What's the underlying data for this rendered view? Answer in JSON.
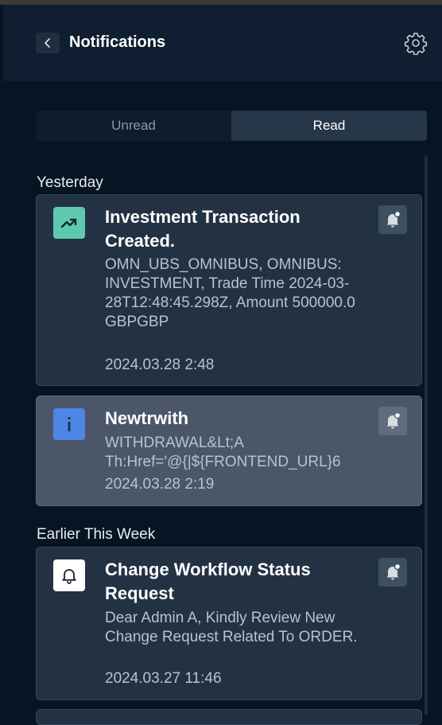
{
  "header": {
    "title": "Notifications",
    "back_icon": "chevron-left-icon",
    "settings_icon": "gear-icon"
  },
  "tabs": [
    {
      "label": "Unread",
      "active": false
    },
    {
      "label": "Read",
      "active": true
    }
  ],
  "sections": [
    {
      "label": "Yesterday",
      "items": [
        {
          "icon": "trending-up-icon",
          "icon_color": "#5ec9b0",
          "title": "Investment Transaction Created.",
          "body": "OMN_UBS_OMNIBUS, OMNIBUS: INVESTMENT, Trade Time 2024-03-28T12:48:45.298Z, Amount 500000.0 GBPGBP",
          "time": "2024.03.28 2:48"
        },
        {
          "icon": "info-icon",
          "icon_color": "#4f86e6",
          "title": "Newtrwith",
          "body": "WITHDRAWAL&Lt;A Th:Href='@{|${FRONTEND_URL}6",
          "time": "2024.03.28 2:19"
        }
      ]
    },
    {
      "label": "Earlier This Week",
      "items": [
        {
          "icon": "bell-icon",
          "icon_color": "#ffffff",
          "title": "Change Workflow Status Request",
          "body": "Dear Admin A, Kindly Review New Change Request Related To ORDER.",
          "time": "2024.03.27 11:46"
        }
      ]
    }
  ],
  "colors": {
    "background": "#061423",
    "card": "#233243",
    "card_highlight": "#4b5769",
    "active_tab": "#26374a"
  }
}
